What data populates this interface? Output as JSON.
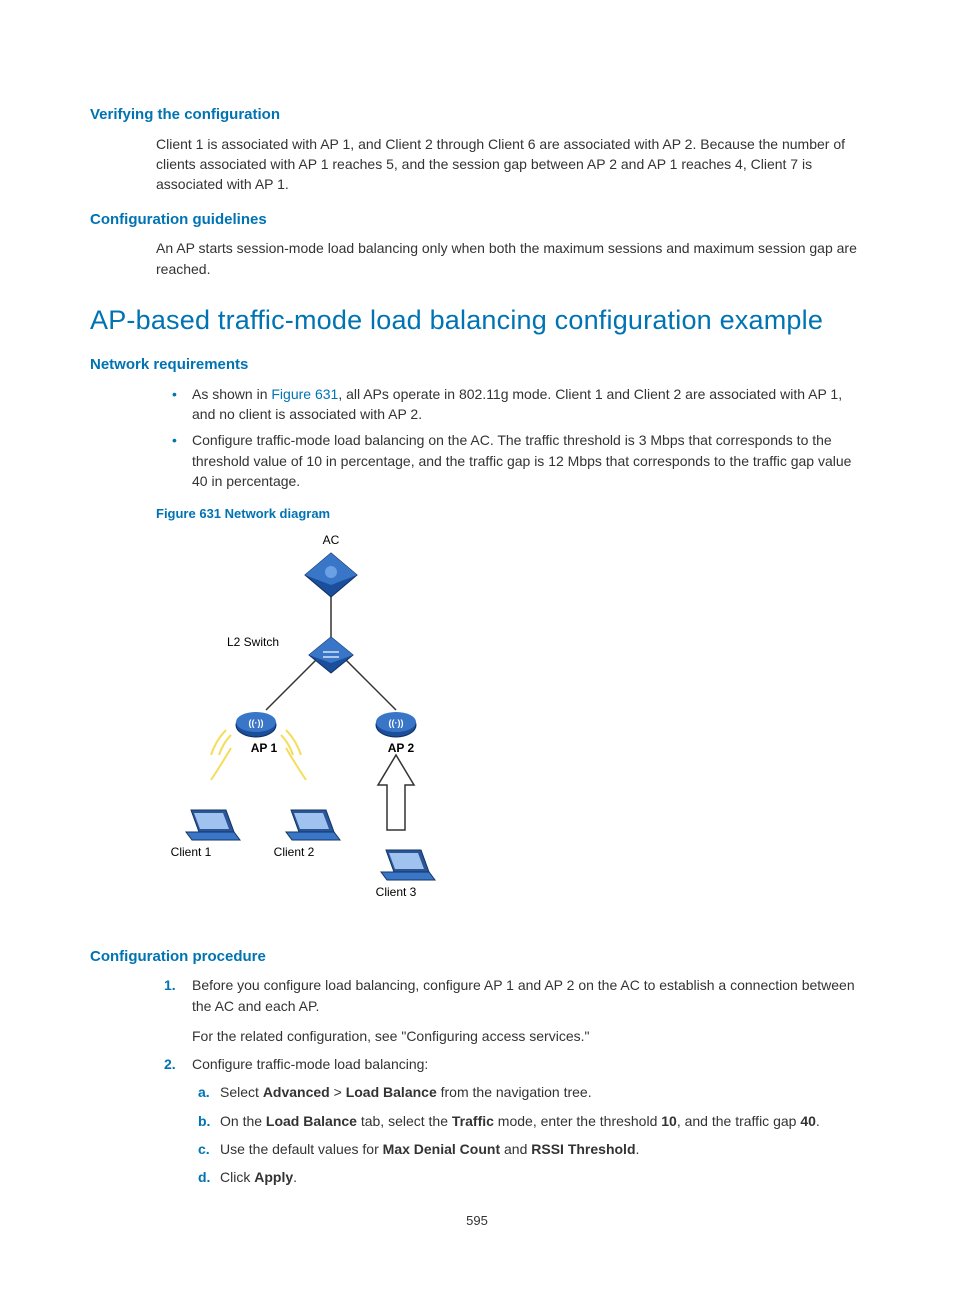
{
  "sec1": {
    "title": "Verifying the configuration",
    "body": "Client 1 is associated with AP 1, and Client 2 through Client 6 are associated with AP 2. Because the number of clients associated with AP 1 reaches 5, and the session gap between AP 2 and AP 1 reaches 4, Client 7 is associated with AP 1."
  },
  "sec2": {
    "title": "Configuration guidelines",
    "body": "An AP starts session-mode load balancing only when both the maximum sessions and maximum session gap are reached."
  },
  "main_heading": "AP-based traffic-mode load balancing configuration example",
  "sec3": {
    "title": "Network requirements",
    "bullet1_pre": "As shown in ",
    "bullet1_link": "Figure 631",
    "bullet1_post": ", all APs operate in 802.11g mode. Client 1 and Client 2 are associated with AP 1, and no client is associated with AP 2.",
    "bullet2": "Configure traffic-mode load balancing on the AC. The traffic threshold is 3 Mbps that corresponds to the threshold value of 10 in percentage, and the traffic gap is 12 Mbps that corresponds to the traffic gap value 40 in percentage."
  },
  "figure": {
    "caption": "Figure 631 Network diagram",
    "labels": {
      "ac": "AC",
      "l2": "L2 Switch",
      "ap1": "AP 1",
      "ap2": "AP 2",
      "c1": "Client 1",
      "c2": "Client 2",
      "c3": "Client 3"
    }
  },
  "sec4": {
    "title": "Configuration procedure",
    "step1a": "Before you configure load balancing, configure AP 1 and AP 2 on the AC to establish a connection between the AC and each AP.",
    "step1b": "For the related configuration, see \"Configuring access services.\"",
    "step2_intro": "Configure traffic-mode load balancing:",
    "step2a_pre": "Select ",
    "step2a_b1": "Advanced",
    "step2a_gt": " > ",
    "step2a_b2": "Load Balance",
    "step2a_post": " from the navigation tree.",
    "step2b_pre": "On the ",
    "step2b_b1": "Load Balance",
    "step2b_mid1": " tab, select the ",
    "step2b_b2": "Traffic",
    "step2b_mid2": " mode, enter the threshold ",
    "step2b_b3": "10",
    "step2b_mid3": ", and the traffic gap ",
    "step2b_b4": "40",
    "step2b_post": ".",
    "step2c_pre": "Use the default values for ",
    "step2c_b1": "Max Denial Count",
    "step2c_mid": " and ",
    "step2c_b2": "RSSI Threshold",
    "step2c_post": ".",
    "step2d_pre": "Click ",
    "step2d_b1": "Apply",
    "step2d_post": "."
  },
  "page_number": "595",
  "markers": {
    "n1": "1.",
    "n2": "2.",
    "a": "a.",
    "b": "b.",
    "c": "c.",
    "d": "d."
  }
}
